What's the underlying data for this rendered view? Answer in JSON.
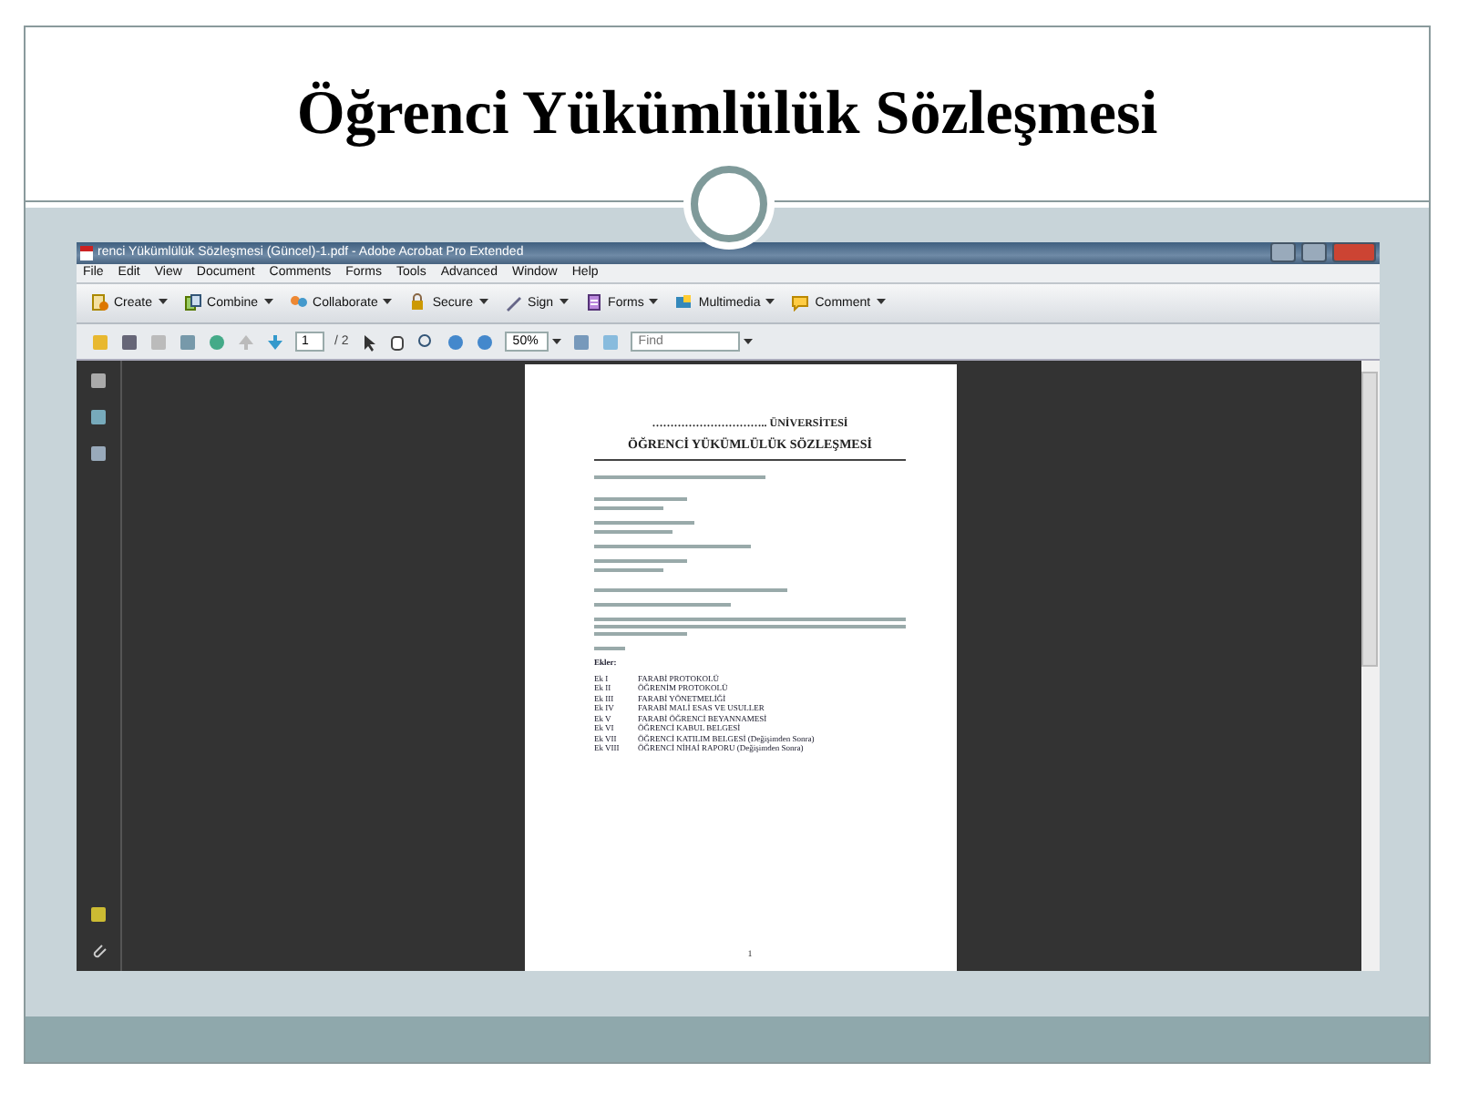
{
  "slide": {
    "title": "Öğrenci Yükümlülük Sözleşmesi"
  },
  "window": {
    "title": "renci Yükümlülük Sözleşmesi (Güncel)-1.pdf - Adobe Acrobat Pro Extended"
  },
  "menu": [
    "File",
    "Edit",
    "View",
    "Document",
    "Comments",
    "Forms",
    "Tools",
    "Advanced",
    "Window",
    "Help"
  ],
  "tasks": [
    {
      "label": "Create",
      "kind": "create"
    },
    {
      "label": "Combine",
      "kind": "combine"
    },
    {
      "label": "Collaborate",
      "kind": "collaborate"
    },
    {
      "label": "Secure",
      "kind": "secure"
    },
    {
      "label": "Sign",
      "kind": "sign"
    },
    {
      "label": "Forms",
      "kind": "forms"
    },
    {
      "label": "Multimedia",
      "kind": "multimedia"
    },
    {
      "label": "Comment",
      "kind": "comment"
    }
  ],
  "nav": {
    "page": "1",
    "of": "/ 2",
    "zoom": "50%",
    "find_placeholder": "Find"
  },
  "document": {
    "heading_1": "………………………….. ÜNİVERSİTESİ",
    "heading_2": "ÖĞRENCİ YÜKÜMLÜLÜK SÖZLEŞMESİ",
    "annex_label": "Ekler:",
    "annexes": [
      {
        "number": "Ek I",
        "title": "FARABİ PROTOKOLÜ"
      },
      {
        "number": "Ek II",
        "title": "ÖĞRENİM PROTOKOLÜ"
      },
      {
        "number": "Ek III",
        "title": "FARABİ YÖNETMELİĞİ"
      },
      {
        "number": "Ek IV",
        "title": "FARABİ MALİ ESAS VE USULLER"
      },
      {
        "number": "Ek V",
        "title": "FARABİ ÖĞRENCİ BEYANNAMESİ"
      },
      {
        "number": "Ek VI",
        "title": "ÖĞRENCİ KABUL BELGESİ"
      },
      {
        "number": "Ek VII",
        "title": "ÖĞRENCİ KATILIM BELGESİ (Değişimden Sonra)"
      },
      {
        "number": "Ek VIII",
        "title": "ÖĞRENCİ NİHAİ RAPORU (Değişimden Sonra)"
      }
    ],
    "page_number": "1"
  }
}
